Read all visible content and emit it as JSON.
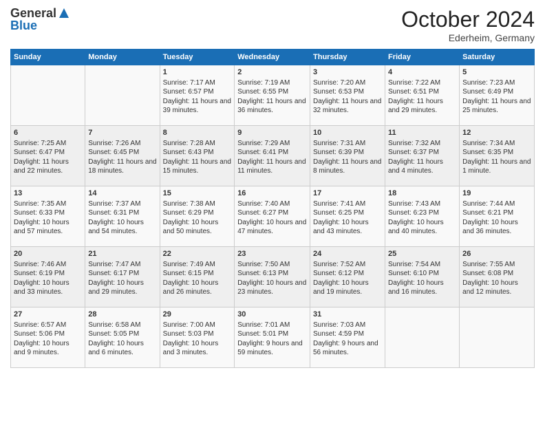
{
  "header": {
    "logo_line1": "General",
    "logo_line2": "Blue",
    "month": "October 2024",
    "location": "Ederheim, Germany"
  },
  "days_of_week": [
    "Sunday",
    "Monday",
    "Tuesday",
    "Wednesday",
    "Thursday",
    "Friday",
    "Saturday"
  ],
  "weeks": [
    [
      {
        "day": "",
        "content": ""
      },
      {
        "day": "",
        "content": ""
      },
      {
        "day": "1",
        "content": "Sunrise: 7:17 AM\nSunset: 6:57 PM\nDaylight: 11 hours and 39 minutes."
      },
      {
        "day": "2",
        "content": "Sunrise: 7:19 AM\nSunset: 6:55 PM\nDaylight: 11 hours and 36 minutes."
      },
      {
        "day": "3",
        "content": "Sunrise: 7:20 AM\nSunset: 6:53 PM\nDaylight: 11 hours and 32 minutes."
      },
      {
        "day": "4",
        "content": "Sunrise: 7:22 AM\nSunset: 6:51 PM\nDaylight: 11 hours and 29 minutes."
      },
      {
        "day": "5",
        "content": "Sunrise: 7:23 AM\nSunset: 6:49 PM\nDaylight: 11 hours and 25 minutes."
      }
    ],
    [
      {
        "day": "6",
        "content": "Sunrise: 7:25 AM\nSunset: 6:47 PM\nDaylight: 11 hours and 22 minutes."
      },
      {
        "day": "7",
        "content": "Sunrise: 7:26 AM\nSunset: 6:45 PM\nDaylight: 11 hours and 18 minutes."
      },
      {
        "day": "8",
        "content": "Sunrise: 7:28 AM\nSunset: 6:43 PM\nDaylight: 11 hours and 15 minutes."
      },
      {
        "day": "9",
        "content": "Sunrise: 7:29 AM\nSunset: 6:41 PM\nDaylight: 11 hours and 11 minutes."
      },
      {
        "day": "10",
        "content": "Sunrise: 7:31 AM\nSunset: 6:39 PM\nDaylight: 11 hours and 8 minutes."
      },
      {
        "day": "11",
        "content": "Sunrise: 7:32 AM\nSunset: 6:37 PM\nDaylight: 11 hours and 4 minutes."
      },
      {
        "day": "12",
        "content": "Sunrise: 7:34 AM\nSunset: 6:35 PM\nDaylight: 11 hours and 1 minute."
      }
    ],
    [
      {
        "day": "13",
        "content": "Sunrise: 7:35 AM\nSunset: 6:33 PM\nDaylight: 10 hours and 57 minutes."
      },
      {
        "day": "14",
        "content": "Sunrise: 7:37 AM\nSunset: 6:31 PM\nDaylight: 10 hours and 54 minutes."
      },
      {
        "day": "15",
        "content": "Sunrise: 7:38 AM\nSunset: 6:29 PM\nDaylight: 10 hours and 50 minutes."
      },
      {
        "day": "16",
        "content": "Sunrise: 7:40 AM\nSunset: 6:27 PM\nDaylight: 10 hours and 47 minutes."
      },
      {
        "day": "17",
        "content": "Sunrise: 7:41 AM\nSunset: 6:25 PM\nDaylight: 10 hours and 43 minutes."
      },
      {
        "day": "18",
        "content": "Sunrise: 7:43 AM\nSunset: 6:23 PM\nDaylight: 10 hours and 40 minutes."
      },
      {
        "day": "19",
        "content": "Sunrise: 7:44 AM\nSunset: 6:21 PM\nDaylight: 10 hours and 36 minutes."
      }
    ],
    [
      {
        "day": "20",
        "content": "Sunrise: 7:46 AM\nSunset: 6:19 PM\nDaylight: 10 hours and 33 minutes."
      },
      {
        "day": "21",
        "content": "Sunrise: 7:47 AM\nSunset: 6:17 PM\nDaylight: 10 hours and 29 minutes."
      },
      {
        "day": "22",
        "content": "Sunrise: 7:49 AM\nSunset: 6:15 PM\nDaylight: 10 hours and 26 minutes."
      },
      {
        "day": "23",
        "content": "Sunrise: 7:50 AM\nSunset: 6:13 PM\nDaylight: 10 hours and 23 minutes."
      },
      {
        "day": "24",
        "content": "Sunrise: 7:52 AM\nSunset: 6:12 PM\nDaylight: 10 hours and 19 minutes."
      },
      {
        "day": "25",
        "content": "Sunrise: 7:54 AM\nSunset: 6:10 PM\nDaylight: 10 hours and 16 minutes."
      },
      {
        "day": "26",
        "content": "Sunrise: 7:55 AM\nSunset: 6:08 PM\nDaylight: 10 hours and 12 minutes."
      }
    ],
    [
      {
        "day": "27",
        "content": "Sunrise: 6:57 AM\nSunset: 5:06 PM\nDaylight: 10 hours and 9 minutes."
      },
      {
        "day": "28",
        "content": "Sunrise: 6:58 AM\nSunset: 5:05 PM\nDaylight: 10 hours and 6 minutes."
      },
      {
        "day": "29",
        "content": "Sunrise: 7:00 AM\nSunset: 5:03 PM\nDaylight: 10 hours and 3 minutes."
      },
      {
        "day": "30",
        "content": "Sunrise: 7:01 AM\nSunset: 5:01 PM\nDaylight: 9 hours and 59 minutes."
      },
      {
        "day": "31",
        "content": "Sunrise: 7:03 AM\nSunset: 4:59 PM\nDaylight: 9 hours and 56 minutes."
      },
      {
        "day": "",
        "content": ""
      },
      {
        "day": "",
        "content": ""
      }
    ]
  ]
}
